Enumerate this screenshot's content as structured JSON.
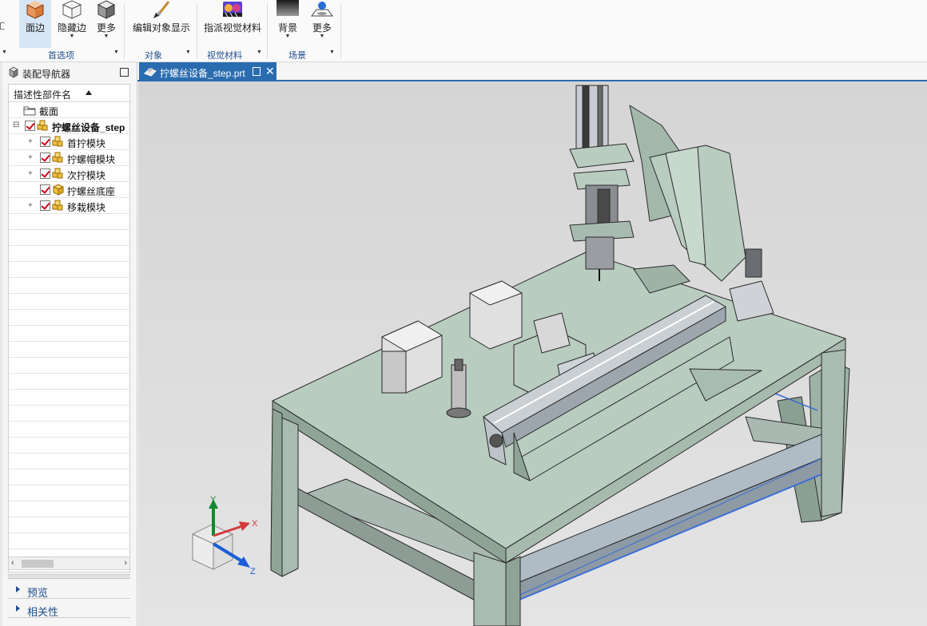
{
  "ribbon": {
    "buttons": [
      {
        "label": "面边",
        "icon": "shaded-cube-icon",
        "active": true
      },
      {
        "label": "隐藏边",
        "icon": "hidden-edge-cube-icon"
      },
      {
        "label": "更多",
        "icon": "more-cube-icon"
      },
      {
        "label": "编辑对象显示",
        "icon": "paint-brush-icon"
      },
      {
        "label": "指派视觉材料",
        "icon": "visual-material-icon"
      },
      {
        "label": "背景",
        "icon": "background-icon"
      },
      {
        "label": "更多",
        "icon": "scene-more-icon"
      }
    ],
    "groups": [
      "首选项",
      "对象",
      "视觉材料",
      "场景"
    ]
  },
  "navigator": {
    "title": "装配导航器",
    "column_header": "描述性部件名",
    "tree": [
      {
        "label": "截面",
        "type": "folder"
      },
      {
        "label": "拧螺丝设备_step",
        "type": "root"
      },
      {
        "label": "首拧模块",
        "type": "assembly"
      },
      {
        "label": "拧螺帽模块",
        "type": "assembly"
      },
      {
        "label": "次拧模块",
        "type": "assembly"
      },
      {
        "label": "拧螺丝底座",
        "type": "part"
      },
      {
        "label": "移栽模块",
        "type": "assembly"
      }
    ],
    "panels": [
      "预览",
      "相关性"
    ]
  },
  "document": {
    "tab_title": "拧螺丝设备_step.prt"
  },
  "triad": {
    "x": "X",
    "y": "Y",
    "z": "Z"
  },
  "colors": {
    "accent": "#2a6cb0",
    "model": "#b9ccc0",
    "check": "#d0021b"
  }
}
